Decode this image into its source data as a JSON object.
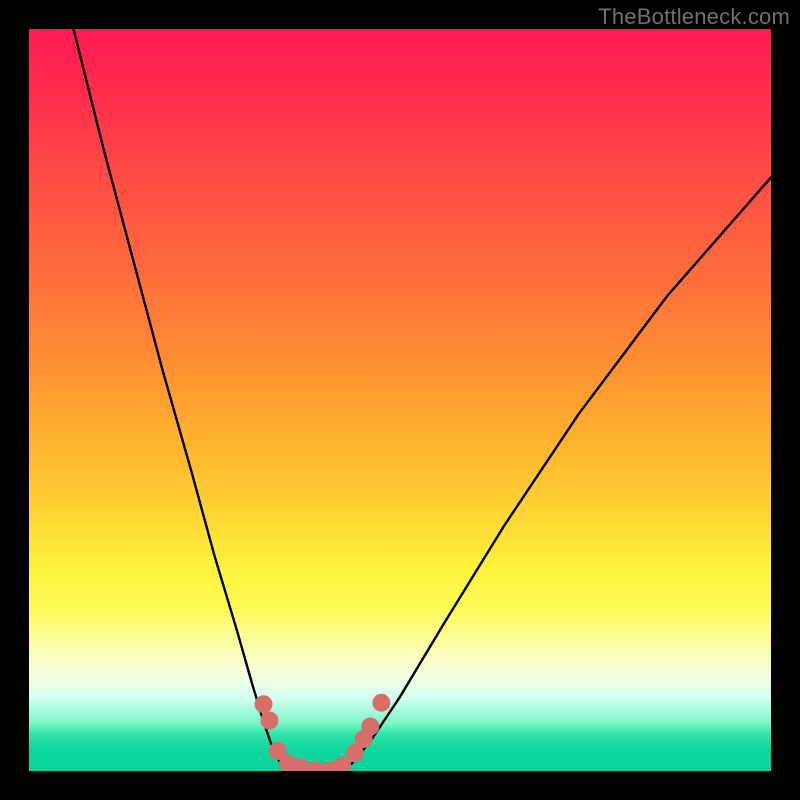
{
  "watermark": "TheBottleneck.com",
  "chart_data": {
    "type": "line",
    "title": "",
    "xlabel": "",
    "ylabel": "",
    "xlim": [
      0,
      1
    ],
    "ylim": [
      0,
      1
    ],
    "series": [
      {
        "name": "curve-left",
        "x": [
          0.06,
          0.1,
          0.14,
          0.18,
          0.22,
          0.25,
          0.28,
          0.3,
          0.315,
          0.325,
          0.333,
          0.34
        ],
        "y": [
          1.0,
          0.84,
          0.69,
          0.54,
          0.4,
          0.29,
          0.19,
          0.12,
          0.07,
          0.04,
          0.02,
          0.01
        ]
      },
      {
        "name": "valley-floor",
        "x": [
          0.34,
          0.36,
          0.38,
          0.4,
          0.42,
          0.435
        ],
        "y": [
          0.01,
          0.002,
          0.0,
          0.0,
          0.002,
          0.01
        ]
      },
      {
        "name": "curve-right",
        "x": [
          0.435,
          0.46,
          0.5,
          0.56,
          0.64,
          0.74,
          0.86,
          1.0
        ],
        "y": [
          0.01,
          0.04,
          0.1,
          0.2,
          0.33,
          0.48,
          0.64,
          0.8
        ]
      }
    ],
    "markers": {
      "name": "highlight-dots",
      "color": "#d76e6b",
      "points": [
        {
          "x": 0.316,
          "y": 0.09
        },
        {
          "x": 0.324,
          "y": 0.068
        },
        {
          "x": 0.335,
          "y": 0.027
        },
        {
          "x": 0.349,
          "y": 0.01
        },
        {
          "x": 0.366,
          "y": 0.005
        },
        {
          "x": 0.386,
          "y": 0.001
        },
        {
          "x": 0.406,
          "y": 0.001
        },
        {
          "x": 0.422,
          "y": 0.007
        },
        {
          "x": 0.439,
          "y": 0.024
        },
        {
          "x": 0.451,
          "y": 0.043
        },
        {
          "x": 0.46,
          "y": 0.06
        },
        {
          "x": 0.475,
          "y": 0.092
        }
      ]
    },
    "gradient_stops": [
      {
        "pos": 0.0,
        "color": "#ff1a53"
      },
      {
        "pos": 0.45,
        "color": "#ff8c33"
      },
      {
        "pos": 0.75,
        "color": "#fff03a"
      },
      {
        "pos": 0.93,
        "color": "#7cf7c9"
      },
      {
        "pos": 1.0,
        "color": "#0ad49a"
      }
    ]
  }
}
